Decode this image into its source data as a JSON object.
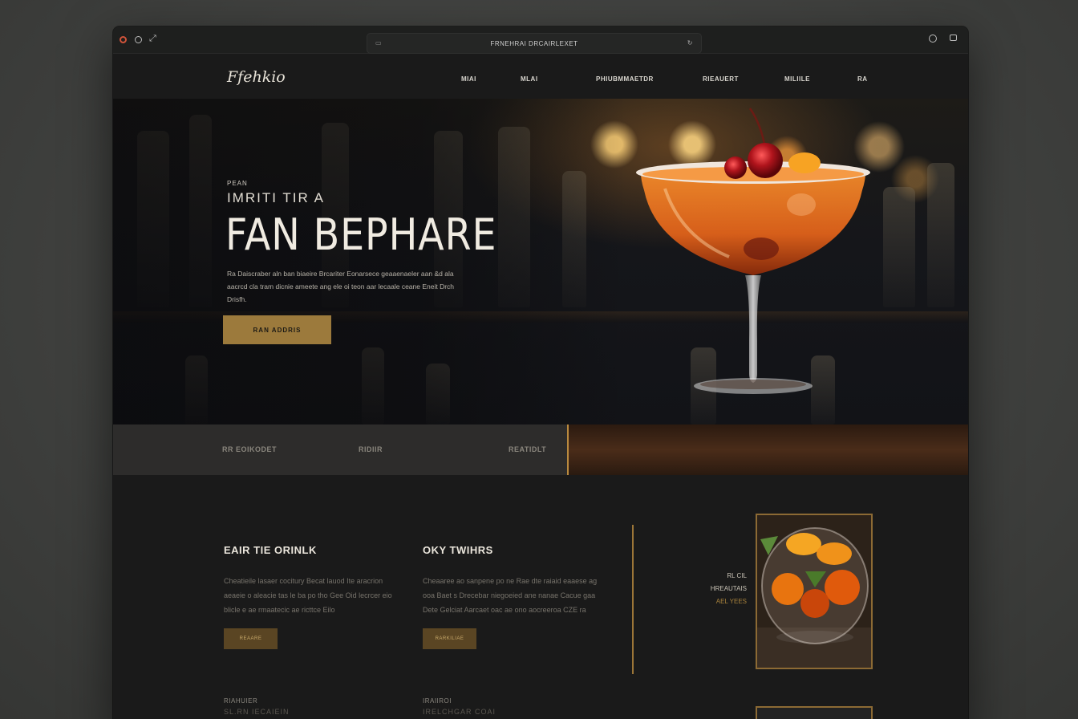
{
  "browser": {
    "url_text": "FRNEHRAI DRCAIRLEXET",
    "addr_left_icon": "tab-icon",
    "addr_right_icon": "reload-icon"
  },
  "nav": {
    "logo": "Ffehkio",
    "items": [
      "MIAI",
      "MLAI",
      "PHIUBMMAETDR",
      "RIEAUERT",
      "MILIILE",
      "RA"
    ]
  },
  "hero": {
    "eyebrow": "PEAN",
    "kicker": "IMRITI TIR A",
    "title": "FAN BEPHARE",
    "description": "Ra Daiscraber aln ban biaeire Brcariter Eonarsece geaaenaeler aan &d ala aacrcd cla tram dicnie ameete ang ele oi teon aar lecaale ceane Eneit Drch Drisfh.",
    "cta_label": "RAN ADDRIS"
  },
  "strip": {
    "items": [
      "RR EOIKODET",
      "RIDIIR",
      "REATIDLT"
    ]
  },
  "columns": [
    {
      "title": "EAIR TIE ORINLK",
      "body": "Cheatieile lasaer cocitury Becat lauod Ite aracrion aeaeie o aleacie tas le ba po tho Gee Oid lecrcer eio blicle e ae rmaatecic ae ricttce Eilo",
      "button": "REAARE"
    },
    {
      "title": "OKY TWIHRS",
      "body": "Cheaaree ao sanpene po ne Rae dte raiaid eaaese ag ooa Baet s Drecebar niegoeied ane nanae Cacue gaa Dete Gelciat Aarcaet oac ae ono aocreeroa CZE ra",
      "button": "RARKILIAE"
    }
  ],
  "column_footers": [
    "RIAHUIER",
    "IRAIIROI"
  ],
  "column_footer_text": [
    "SL.RN IECAIEIN",
    "IRELCHGAR COAI"
  ],
  "side": {
    "line1": "RL CIL",
    "line2": "HREAUTAIS",
    "line3": "AEL YEES"
  },
  "colors": {
    "accent_gold": "#9c7a3c",
    "background": "#1a1a1a",
    "text_light": "#f0ebe1"
  }
}
